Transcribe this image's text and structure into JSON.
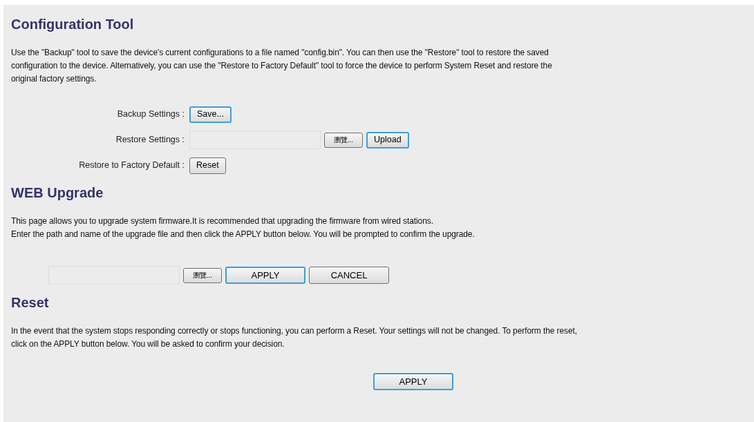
{
  "sections": [
    {
      "title": "Configuration Tool",
      "paragraph": [
        "Use the \"Backup\" tool to save the device's current configurations to a file named \"config.bin\". You can then use the \"Restore\" tool to restore the saved",
        "configuration to the device. Alternatively, you can use the \"Restore to Factory Default\" tool to force the device to perform System Reset and restore the",
        "original factory settings."
      ],
      "form_rows": [
        {
          "label": "Backup Settings :",
          "controls": [
            {
              "kind": "button",
              "text": "Save...",
              "focused": true
            }
          ]
        },
        {
          "label": "Restore Settings :",
          "controls": [
            {
              "kind": "file"
            },
            {
              "kind": "browse",
              "text": "瀏覽..."
            },
            {
              "kind": "button",
              "text": "Upload",
              "focused": true
            }
          ]
        },
        {
          "label": "Restore to Factory Default :",
          "controls": [
            {
              "kind": "button",
              "text": "Reset",
              "focused": false
            }
          ]
        }
      ]
    },
    {
      "title": "WEB Upgrade",
      "paragraph": [
        "This page allows you to upgrade system firmware.It is recommended that upgrading the firmware from wired stations.",
        "Enter the path and name of the upgrade file and then click the APPLY button below. You will be prompted to confirm the upgrade."
      ],
      "controls": [
        {
          "kind": "file"
        },
        {
          "kind": "browse",
          "text": "瀏覽..."
        },
        {
          "kind": "wide",
          "text": "APPLY",
          "focused": true
        },
        {
          "kind": "wide",
          "text": "CANCEL",
          "focused": false
        }
      ]
    },
    {
      "title": "Reset",
      "paragraph": [
        "In the event that the system stops responding correctly or stops functioning, you can perform a Reset. Your settings will not be changed. To perform the reset,",
        "click on the APPLY button below. You will be asked to confirm your decision."
      ],
      "centered_controls": [
        {
          "kind": "wide",
          "text": "APPLY",
          "focused": true
        }
      ]
    }
  ]
}
